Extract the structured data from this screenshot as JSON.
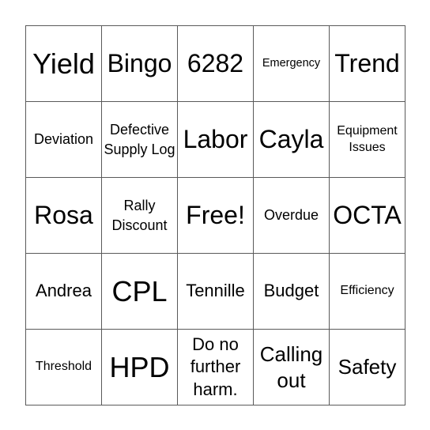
{
  "card": {
    "cells": [
      [
        "Yield",
        "Bingo",
        "6282",
        "Emergency",
        "Trend"
      ],
      [
        "Deviation",
        "Defective Supply Log",
        "Labor",
        "Cayla",
        "Equipment Issues"
      ],
      [
        "Rosa",
        "Rally Discount",
        "Free!",
        "Overdue",
        "OCTA"
      ],
      [
        "Andrea",
        "CPL",
        "Tennille",
        "Budget",
        "Efficiency"
      ],
      [
        "Threshold",
        "HPD",
        "Do no further harm.",
        "Calling out",
        "Safety"
      ]
    ],
    "free_space": "Free!",
    "border_color": "#5a5a5a"
  }
}
